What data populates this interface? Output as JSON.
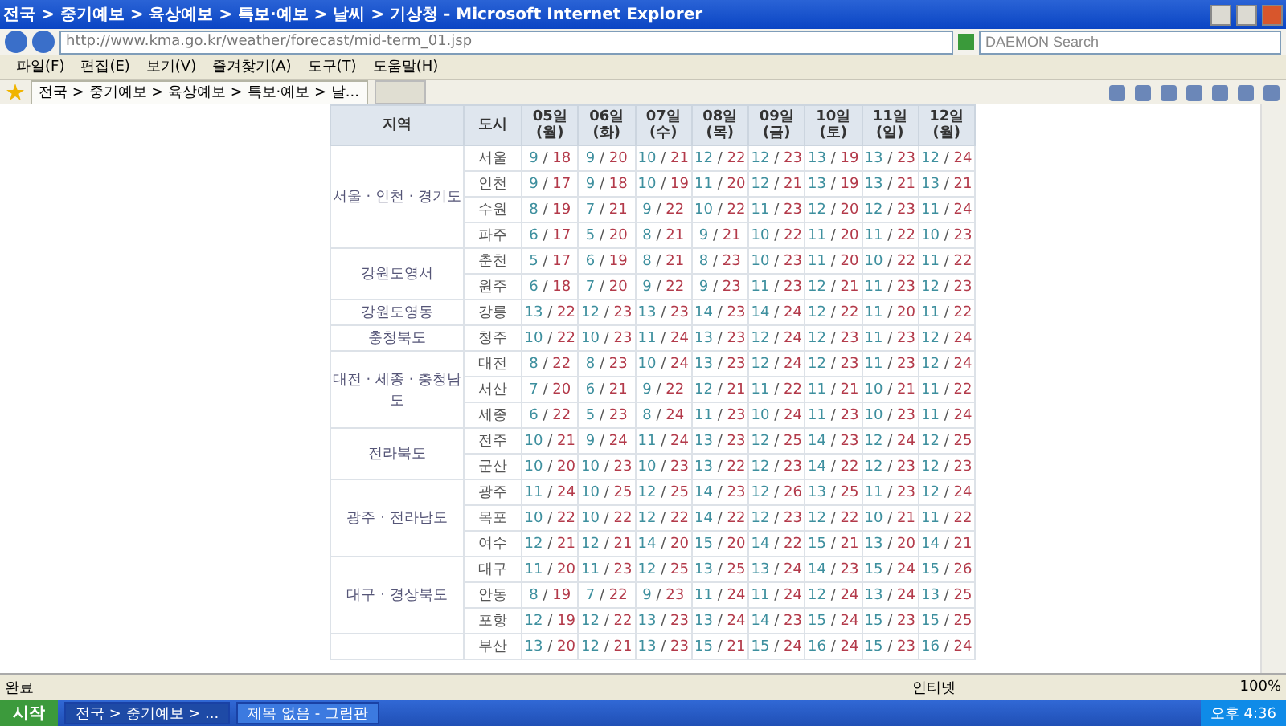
{
  "window": {
    "title": "전국 > 중기예보 > 육상예보 > 특보·예보 > 날씨 > 기상청 - Microsoft Internet Explorer"
  },
  "address_bar": {
    "url": "http://www.kma.go.kr/weather/forecast/mid-term_01.jsp"
  },
  "search": {
    "placeholder": "DAEMON Search"
  },
  "menu": [
    "파일(F)",
    "편집(E)",
    "보기(V)",
    "즐겨찾기(A)",
    "도구(T)",
    "도움말(H)"
  ],
  "tabs": [
    {
      "label": "전국 > 중기예보 > 육상예보 > 특보·예보 > 날...",
      "selected": true
    }
  ],
  "table": {
    "columns": [
      {
        "label": "지역"
      },
      {
        "label": "도시"
      }
    ],
    "days": [
      {
        "date": "05일",
        "weekday": "(월)"
      },
      {
        "date": "06일",
        "weekday": "(화)"
      },
      {
        "date": "07일",
        "weekday": "(수)"
      },
      {
        "date": "08일",
        "weekday": "(목)"
      },
      {
        "date": "09일",
        "weekday": "(금)"
      },
      {
        "date": "10일",
        "weekday": "(토)"
      },
      {
        "date": "11일",
        "weekday": "(일)"
      },
      {
        "date": "12일",
        "weekday": "(월)"
      }
    ],
    "separator": "/",
    "groups": [
      {
        "region": "서울 · 인천 · 경기도",
        "cities": [
          {
            "city": "서울",
            "temps": [
              [
                "9",
                "18"
              ],
              [
                "9",
                "20"
              ],
              [
                "10",
                "21"
              ],
              [
                "12",
                "22"
              ],
              [
                "12",
                "23"
              ],
              [
                "13",
                "19"
              ],
              [
                "13",
                "23"
              ],
              [
                "12",
                "24"
              ]
            ]
          },
          {
            "city": "인천",
            "temps": [
              [
                "9",
                "17"
              ],
              [
                "9",
                "18"
              ],
              [
                "10",
                "19"
              ],
              [
                "11",
                "20"
              ],
              [
                "12",
                "21"
              ],
              [
                "13",
                "19"
              ],
              [
                "13",
                "21"
              ],
              [
                "13",
                "21"
              ]
            ]
          },
          {
            "city": "수원",
            "temps": [
              [
                "8",
                "19"
              ],
              [
                "7",
                "21"
              ],
              [
                "9",
                "22"
              ],
              [
                "10",
                "22"
              ],
              [
                "11",
                "23"
              ],
              [
                "12",
                "20"
              ],
              [
                "12",
                "23"
              ],
              [
                "11",
                "24"
              ]
            ]
          },
          {
            "city": "파주",
            "temps": [
              [
                "6",
                "17"
              ],
              [
                "5",
                "20"
              ],
              [
                "8",
                "21"
              ],
              [
                "9",
                "21"
              ],
              [
                "10",
                "22"
              ],
              [
                "11",
                "20"
              ],
              [
                "11",
                "22"
              ],
              [
                "10",
                "23"
              ]
            ]
          }
        ]
      },
      {
        "region": "강원도영서",
        "cities": [
          {
            "city": "춘천",
            "temps": [
              [
                "5",
                "17"
              ],
              [
                "6",
                "19"
              ],
              [
                "8",
                "21"
              ],
              [
                "8",
                "23"
              ],
              [
                "10",
                "23"
              ],
              [
                "11",
                "20"
              ],
              [
                "10",
                "22"
              ],
              [
                "11",
                "22"
              ]
            ]
          },
          {
            "city": "원주",
            "temps": [
              [
                "6",
                "18"
              ],
              [
                "7",
                "20"
              ],
              [
                "9",
                "22"
              ],
              [
                "9",
                "23"
              ],
              [
                "11",
                "23"
              ],
              [
                "12",
                "21"
              ],
              [
                "11",
                "23"
              ],
              [
                "12",
                "23"
              ]
            ]
          }
        ]
      },
      {
        "region": "강원도영동",
        "cities": [
          {
            "city": "강릉",
            "temps": [
              [
                "13",
                "22"
              ],
              [
                "12",
                "23"
              ],
              [
                "13",
                "23"
              ],
              [
                "14",
                "23"
              ],
              [
                "14",
                "24"
              ],
              [
                "12",
                "22"
              ],
              [
                "11",
                "20"
              ],
              [
                "11",
                "22"
              ]
            ]
          }
        ]
      },
      {
        "region": "충청북도",
        "cities": [
          {
            "city": "청주",
            "temps": [
              [
                "10",
                "22"
              ],
              [
                "10",
                "23"
              ],
              [
                "11",
                "24"
              ],
              [
                "13",
                "23"
              ],
              [
                "12",
                "24"
              ],
              [
                "12",
                "23"
              ],
              [
                "11",
                "23"
              ],
              [
                "12",
                "24"
              ]
            ]
          }
        ]
      },
      {
        "region": "대전 · 세종 · 충청남도",
        "cities": [
          {
            "city": "대전",
            "temps": [
              [
                "8",
                "22"
              ],
              [
                "8",
                "23"
              ],
              [
                "10",
                "24"
              ],
              [
                "13",
                "23"
              ],
              [
                "12",
                "24"
              ],
              [
                "12",
                "23"
              ],
              [
                "11",
                "23"
              ],
              [
                "12",
                "24"
              ]
            ]
          },
          {
            "city": "서산",
            "temps": [
              [
                "7",
                "20"
              ],
              [
                "6",
                "21"
              ],
              [
                "9",
                "22"
              ],
              [
                "12",
                "21"
              ],
              [
                "11",
                "22"
              ],
              [
                "11",
                "21"
              ],
              [
                "10",
                "21"
              ],
              [
                "11",
                "22"
              ]
            ]
          },
          {
            "city": "세종",
            "temps": [
              [
                "6",
                "22"
              ],
              [
                "5",
                "23"
              ],
              [
                "8",
                "24"
              ],
              [
                "11",
                "23"
              ],
              [
                "10",
                "24"
              ],
              [
                "11",
                "23"
              ],
              [
                "10",
                "23"
              ],
              [
                "11",
                "24"
              ]
            ]
          }
        ]
      },
      {
        "region": "전라북도",
        "cities": [
          {
            "city": "전주",
            "temps": [
              [
                "10",
                "21"
              ],
              [
                "9",
                "24"
              ],
              [
                "11",
                "24"
              ],
              [
                "13",
                "23"
              ],
              [
                "12",
                "25"
              ],
              [
                "14",
                "23"
              ],
              [
                "12",
                "24"
              ],
              [
                "12",
                "25"
              ]
            ]
          },
          {
            "city": "군산",
            "temps": [
              [
                "10",
                "20"
              ],
              [
                "10",
                "23"
              ],
              [
                "10",
                "23"
              ],
              [
                "13",
                "22"
              ],
              [
                "12",
                "23"
              ],
              [
                "14",
                "22"
              ],
              [
                "12",
                "23"
              ],
              [
                "12",
                "23"
              ]
            ]
          }
        ]
      },
      {
        "region": "광주 · 전라남도",
        "cities": [
          {
            "city": "광주",
            "temps": [
              [
                "11",
                "24"
              ],
              [
                "10",
                "25"
              ],
              [
                "12",
                "25"
              ],
              [
                "14",
                "23"
              ],
              [
                "12",
                "26"
              ],
              [
                "13",
                "25"
              ],
              [
                "11",
                "23"
              ],
              [
                "12",
                "24"
              ]
            ]
          },
          {
            "city": "목포",
            "temps": [
              [
                "10",
                "22"
              ],
              [
                "10",
                "22"
              ],
              [
                "12",
                "22"
              ],
              [
                "14",
                "22"
              ],
              [
                "12",
                "23"
              ],
              [
                "12",
                "22"
              ],
              [
                "10",
                "21"
              ],
              [
                "11",
                "22"
              ]
            ]
          },
          {
            "city": "여수",
            "temps": [
              [
                "12",
                "21"
              ],
              [
                "12",
                "21"
              ],
              [
                "14",
                "20"
              ],
              [
                "15",
                "20"
              ],
              [
                "14",
                "22"
              ],
              [
                "15",
                "21"
              ],
              [
                "13",
                "20"
              ],
              [
                "14",
                "21"
              ]
            ]
          }
        ]
      },
      {
        "region": "대구 · 경상북도",
        "cities": [
          {
            "city": "대구",
            "temps": [
              [
                "11",
                "20"
              ],
              [
                "11",
                "23"
              ],
              [
                "12",
                "25"
              ],
              [
                "13",
                "25"
              ],
              [
                "13",
                "24"
              ],
              [
                "14",
                "23"
              ],
              [
                "15",
                "24"
              ],
              [
                "15",
                "26"
              ]
            ]
          },
          {
            "city": "안동",
            "temps": [
              [
                "8",
                "19"
              ],
              [
                "7",
                "22"
              ],
              [
                "9",
                "23"
              ],
              [
                "11",
                "24"
              ],
              [
                "11",
                "24"
              ],
              [
                "12",
                "24"
              ],
              [
                "13",
                "24"
              ],
              [
                "13",
                "25"
              ]
            ]
          },
          {
            "city": "포항",
            "temps": [
              [
                "12",
                "19"
              ],
              [
                "12",
                "22"
              ],
              [
                "13",
                "23"
              ],
              [
                "13",
                "24"
              ],
              [
                "14",
                "23"
              ],
              [
                "15",
                "24"
              ],
              [
                "15",
                "23"
              ],
              [
                "15",
                "25"
              ]
            ]
          }
        ]
      },
      {
        "cities": [
          {
            "city": "부산",
            "temps": [
              [
                "13",
                "20"
              ],
              [
                "12",
                "21"
              ],
              [
                "13",
                "23"
              ],
              [
                "15",
                "21"
              ],
              [
                "15",
                "24"
              ],
              [
                "16",
                "24"
              ],
              [
                "15",
                "23"
              ],
              [
                "16",
                "24"
              ]
            ]
          }
        ]
      }
    ]
  },
  "status_bar": {
    "text": "완료",
    "zone": "인터넷",
    "zoom": "100%"
  },
  "taskbar": {
    "start": "시작",
    "windows": [
      {
        "label": "전국 > 중기예보 > ...",
        "selected": true
      },
      {
        "label": "제목 없음 - 그림판",
        "selected": false
      }
    ],
    "clock": "오후 4:36"
  }
}
